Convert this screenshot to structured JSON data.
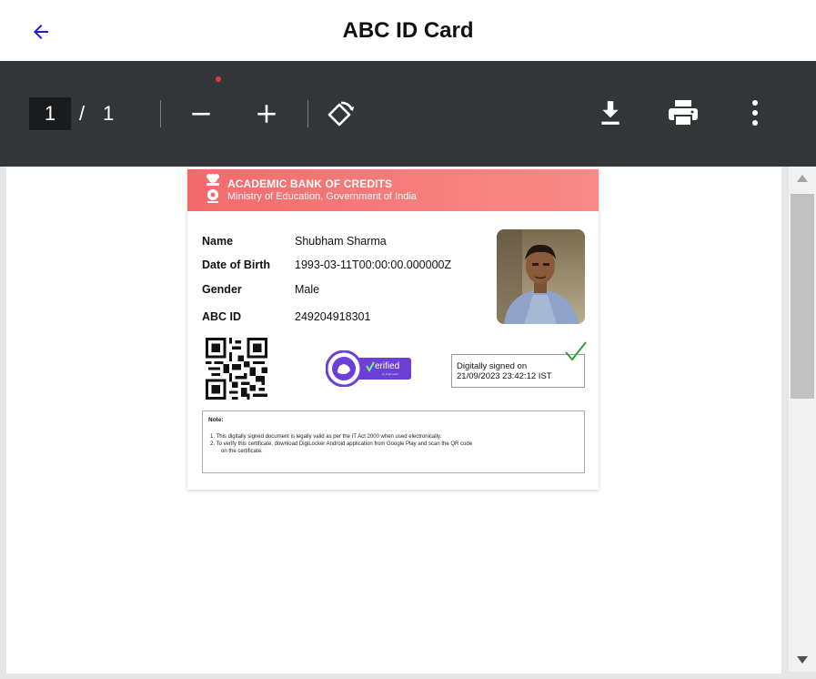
{
  "header": {
    "title": "ABC ID Card",
    "back_icon": "back-arrow-icon"
  },
  "toolbar": {
    "page_current": "1",
    "page_separator": "/",
    "page_total": "1",
    "icons": [
      "zoom-out-icon",
      "zoom-in-icon",
      "rotate-icon",
      "download-icon",
      "print-icon",
      "more-vert-icon"
    ]
  },
  "card": {
    "org_name": "ACADEMIC BANK OF CREDITS",
    "org_subtitle": "Ministry of Education, Government of India",
    "fields": [
      {
        "label": "Name",
        "value": "Shubham Sharma"
      },
      {
        "label": "Date of Birth",
        "value": "1993-03-11T00:00:00.000000Z"
      },
      {
        "label": "Gender",
        "value": "Male"
      },
      {
        "label": "ABC ID",
        "value": "249204918301"
      }
    ],
    "verified_badge": "erified",
    "verified_sub": "by DigiLocker",
    "signed_line1": "Digitally signed on",
    "signed_line2": "21/09/2023 23:42:12 IST",
    "note_title": "Note:",
    "note_items": [
      "1.  This digitally signed document is legally valid as per the IT Act 2000 when used electronically.",
      "2.  To verify this certificate, download DigiLocker Android application from Google Play and scan the QR code",
      "on the certificate."
    ]
  },
  "colors": {
    "toolbar_bg": "#333639",
    "card_header": "#f26b6b",
    "accent_blue": "#1a1adb",
    "verified_purple": "#6c3fd6",
    "check_green": "#2e9e3a"
  }
}
